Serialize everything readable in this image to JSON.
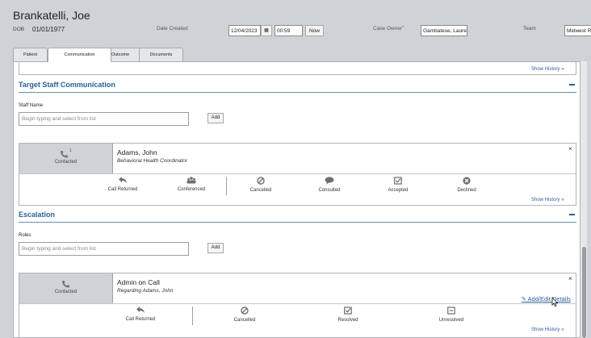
{
  "patient": {
    "name": "Brankatelli, Joe",
    "dob_label": "DOB",
    "dob": "01/01/1977"
  },
  "header": {
    "date_created_label": "Date Created",
    "date": "12/04/2023",
    "time": "00:59",
    "now_label": "Now",
    "case_owner_label": "Case Owner",
    "case_owner_required": "*",
    "case_owner": "Gambatese, Lauren",
    "team_label": "Team",
    "team": "Midwest Re"
  },
  "tabs": [
    "Patient",
    "Communication",
    "Outcome",
    "Documents"
  ],
  "top_card": {
    "show_history": "Show History"
  },
  "target_staff": {
    "title": "Target Staff Communication",
    "field_label": "Staff Name",
    "placeholder": "Begin typing and select from list",
    "add_label": "Add",
    "contact_count": "1",
    "contacted_label": "Contacted",
    "person_name": "Adams, John",
    "person_role": "Behavioral Health Coordinator",
    "actions": [
      "Call Returned",
      "Conferenced",
      "Cancelled",
      "Consulted",
      "Accepted",
      "Declined"
    ],
    "show_history": "Show History",
    "close": "×"
  },
  "escalation": {
    "title": "Escalation",
    "field_label": "Roles",
    "placeholder": "Begin typing and select from list",
    "add_label": "Add",
    "contacted_label": "Contacted",
    "person_name": "Admin on Call",
    "person_sub": "Regarding Adams, John",
    "edit_label": "Add/Edit Details",
    "actions": [
      "Call Returned",
      "Cancelled",
      "Resolved",
      "Unresolved"
    ],
    "show_history": "Show History",
    "close": "×"
  },
  "colors": {
    "accent": "#2b6196",
    "link": "#2a5f9e",
    "header_bg": "#cfd3d8"
  }
}
